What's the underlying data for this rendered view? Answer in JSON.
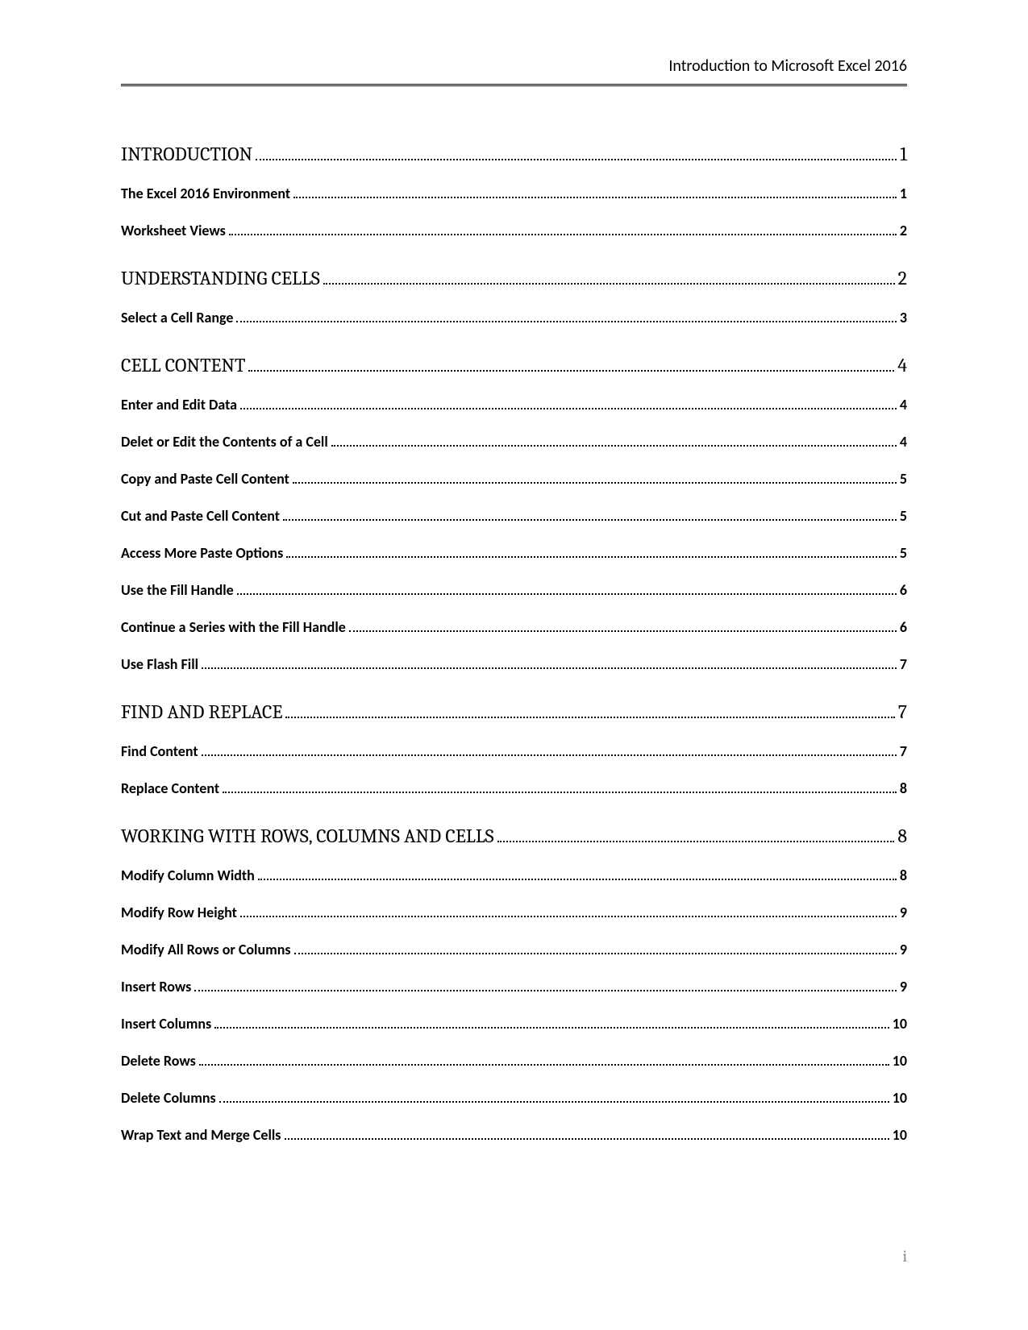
{
  "header": {
    "title": "Introduction to Microsoft Excel 2016"
  },
  "toc": [
    {
      "level": 1,
      "title": "INTRODUCTION",
      "page": "1"
    },
    {
      "level": 2,
      "title": "The Excel 2016 Environment",
      "page": "1"
    },
    {
      "level": 2,
      "title": "Worksheet Views",
      "page": "2"
    },
    {
      "level": 1,
      "title": "UNDERSTANDING CELLS",
      "page": "2"
    },
    {
      "level": 2,
      "title": "Select a Cell Range",
      "page": "3"
    },
    {
      "level": 1,
      "title": "CELL CONTENT",
      "page": "4"
    },
    {
      "level": 2,
      "title": "Enter and Edit Data",
      "page": "4"
    },
    {
      "level": 2,
      "title": "Delet or Edit the Contents of a Cell",
      "page": "4"
    },
    {
      "level": 2,
      "title": "Copy and Paste Cell Content",
      "page": "5"
    },
    {
      "level": 2,
      "title": "Cut and Paste Cell Content",
      "page": "5"
    },
    {
      "level": 2,
      "title": "Access More Paste Options",
      "page": "5"
    },
    {
      "level": 2,
      "title": "Use the Fill Handle",
      "page": "6"
    },
    {
      "level": 2,
      "title": "Continue a Series with the Fill Handle",
      "page": "6"
    },
    {
      "level": 2,
      "title": "Use Flash Fill",
      "page": "7"
    },
    {
      "level": 1,
      "title": "FIND AND REPLACE",
      "page": "7"
    },
    {
      "level": 2,
      "title": "Find Content",
      "page": "7"
    },
    {
      "level": 2,
      "title": "Replace Content",
      "page": "8"
    },
    {
      "level": 1,
      "title": "WORKING WITH ROWS, COLUMNS AND CELLS",
      "page": "8"
    },
    {
      "level": 2,
      "title": "Modify Column Width",
      "page": "8"
    },
    {
      "level": 2,
      "title": "Modify Row Height",
      "page": "9"
    },
    {
      "level": 2,
      "title": "Modify All Rows or Columns",
      "page": "9"
    },
    {
      "level": 2,
      "title": "Insert Rows",
      "page": "9"
    },
    {
      "level": 2,
      "title": "Insert Columns",
      "page": "10"
    },
    {
      "level": 2,
      "title": "Delete Rows",
      "page": "10"
    },
    {
      "level": 2,
      "title": "Delete Columns",
      "page": "10"
    },
    {
      "level": 2,
      "title": "Wrap Text and Merge Cells",
      "page": "10"
    }
  ],
  "footer": {
    "page_number": "i"
  }
}
